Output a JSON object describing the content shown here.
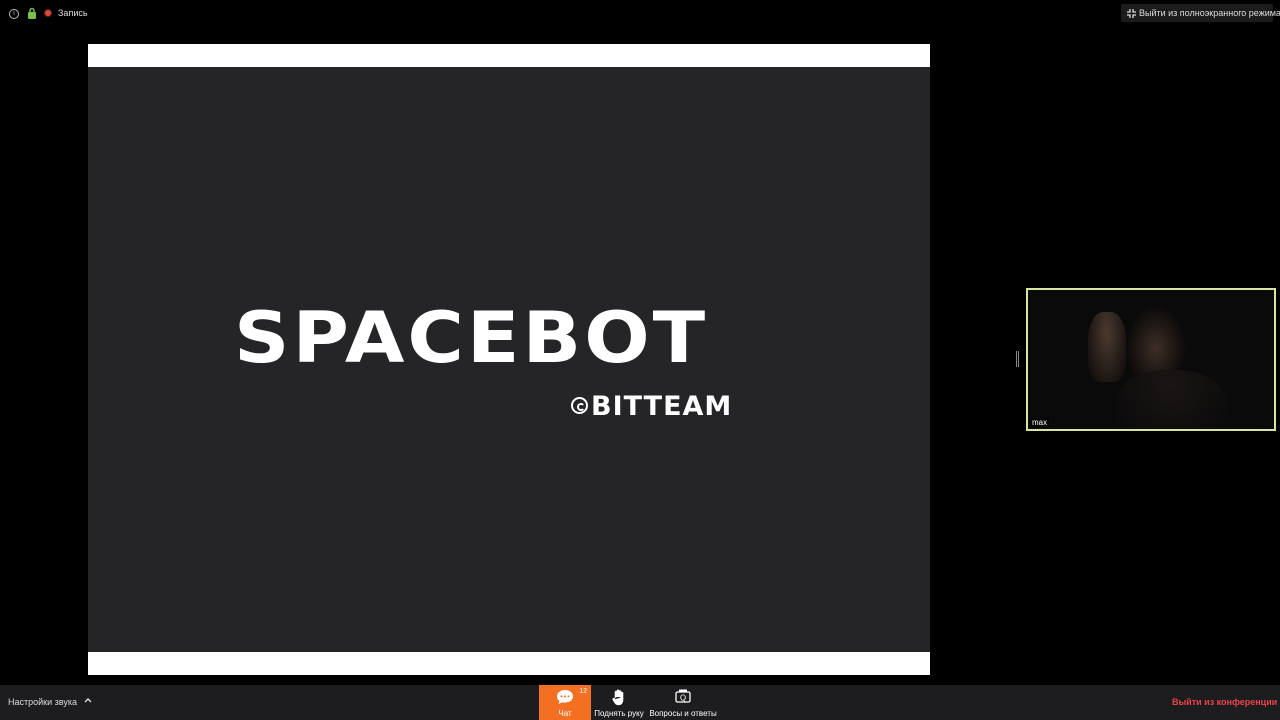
{
  "topbar": {
    "recording_label": "Запись",
    "exit_fullscreen_label": "Выйти из полноэкранного режима"
  },
  "shared_screen": {
    "brand": "SPACEBOT",
    "sub_brand": "BITTEAM"
  },
  "video": {
    "participant_name": "max"
  },
  "toolbar": {
    "audio_settings_label": "Настройки звука",
    "chat_label": "Чат",
    "chat_count": "12",
    "raise_hand_label": "Поднять руку",
    "qa_label": "Вопросы и ответы",
    "leave_label": "Выйти из конференции"
  },
  "colors": {
    "chat_active": "#f36f21",
    "leave_text": "#e8444a",
    "recording_dot": "#e0453b",
    "lock_green": "#7cc242",
    "active_speaker_border": "#d6e6a0"
  }
}
